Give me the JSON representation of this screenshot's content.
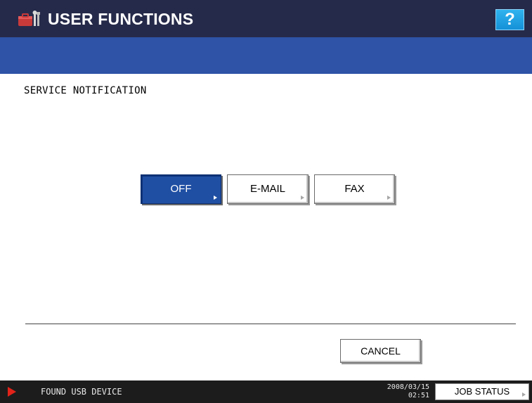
{
  "header": {
    "title": "USER FUNCTIONS",
    "icon": "user-functions-icon",
    "help_label": "?"
  },
  "page": {
    "heading": "SERVICE NOTIFICATION"
  },
  "options": [
    {
      "label": "OFF",
      "selected": true
    },
    {
      "label": "E-MAIL",
      "selected": false
    },
    {
      "label": "FAX",
      "selected": false
    }
  ],
  "footer": {
    "cancel_label": "CANCEL"
  },
  "status": {
    "message": "FOUND USB DEVICE",
    "date": "2008/03/15",
    "time": "02:51",
    "job_status_label": "JOB STATUS"
  },
  "colors": {
    "titlebar": "#262a4a",
    "subbar": "#2e53a7",
    "selected": "#1f4fa3",
    "help": "#1591d8",
    "status_icon": "#e2231a"
  }
}
